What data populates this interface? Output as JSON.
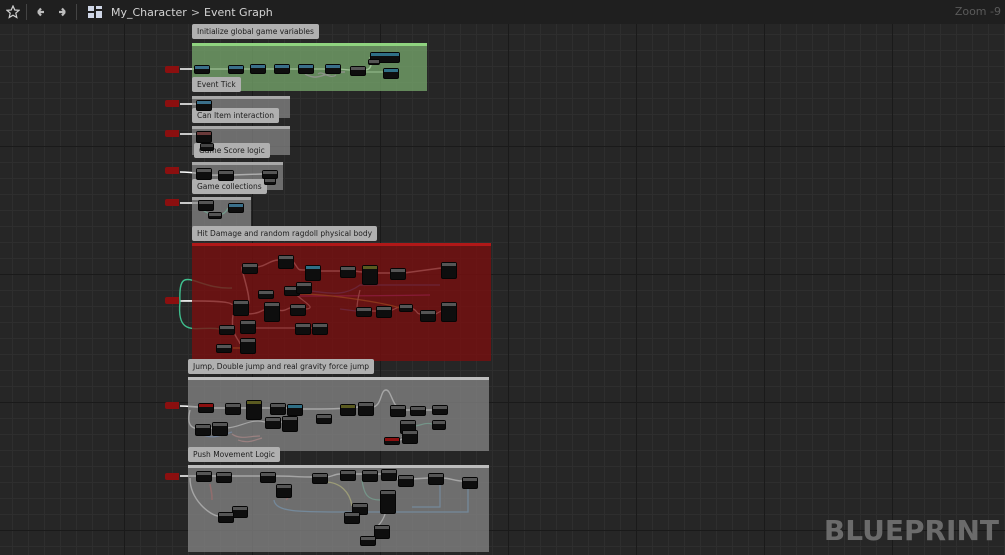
{
  "toolbar": {
    "favorite_icon": "star-icon",
    "back_icon": "arrow-left-icon",
    "forward_icon": "arrow-right-icon",
    "graph_icon": "blueprint-graph-icon",
    "breadcrumb": {
      "asset": "My_Character",
      "separator": ">",
      "graph": "Event Graph"
    },
    "zoom": "Zoom -9"
  },
  "comments": [
    {
      "title": "Initialize global game variables",
      "color": "#5f8a5a"
    },
    {
      "title": "Event Tick",
      "color": "#6b6b6b"
    },
    {
      "title": "Can Item interaction",
      "color": "#6b6b6b"
    },
    {
      "title": "Game Score logic",
      "color": "#6b6b6b"
    },
    {
      "title": "Game collections",
      "color": "#6b6b6b"
    },
    {
      "title": "Hit Damage and random ragdoll physical body",
      "color": "#5e1414"
    },
    {
      "title": "Jump, Double jump and real gravity force jump",
      "color": "#6f6f6f"
    },
    {
      "title": "Push Movement Logic",
      "color": "#6f6f6f"
    }
  ],
  "watermark": "BLUEPRINT"
}
